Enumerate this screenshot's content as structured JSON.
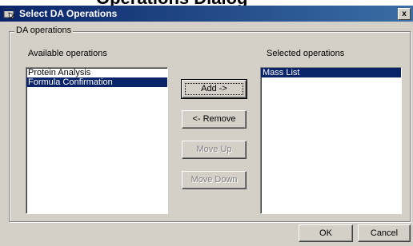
{
  "header": {
    "clipped_text": "Operations Dialog"
  },
  "window": {
    "title": "Select DA Operations",
    "close_glyph": "x"
  },
  "group": {
    "label": "DA operations"
  },
  "available": {
    "label": "Available operations",
    "items": [
      "Protein Analysis",
      "Formula Confirmation"
    ],
    "selected_index": 1
  },
  "selected": {
    "label": "Selected operations",
    "items": [
      "Mass List"
    ],
    "selected_index": 0
  },
  "buttons": {
    "add": "Add ->",
    "remove": "<- Remove",
    "move_up": "Move Up",
    "move_down": "Move Down",
    "ok": "OK",
    "cancel": "Cancel"
  },
  "icons": {
    "app": "dialog-app-icon",
    "close": "close-icon"
  },
  "colors": {
    "titlebar_start": "#0a246a",
    "titlebar_end": "#3a6ea5",
    "selection": "#0a246a",
    "face": "#d4d0c8"
  }
}
